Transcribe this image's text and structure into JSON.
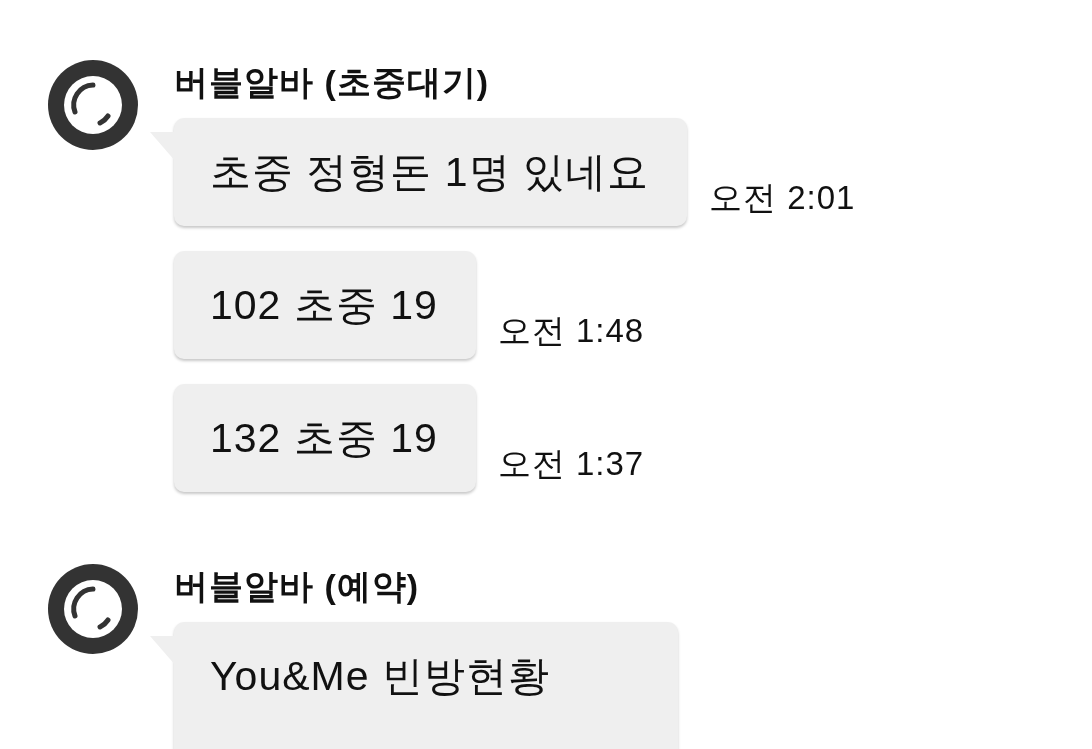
{
  "groups": [
    {
      "sender": "버블알바 (초중대기)",
      "messages": [
        {
          "text": "초중 정형돈 1명 있네요",
          "time": "오전 2:01"
        },
        {
          "text": "102 초중 19",
          "time": "오전 1:48"
        },
        {
          "text": "132 초중 19",
          "time": "오전 1:37"
        }
      ]
    },
    {
      "sender": "버블알바 (예약)",
      "messages": [
        {
          "text": "You&Me 빈방현황"
        }
      ]
    }
  ]
}
